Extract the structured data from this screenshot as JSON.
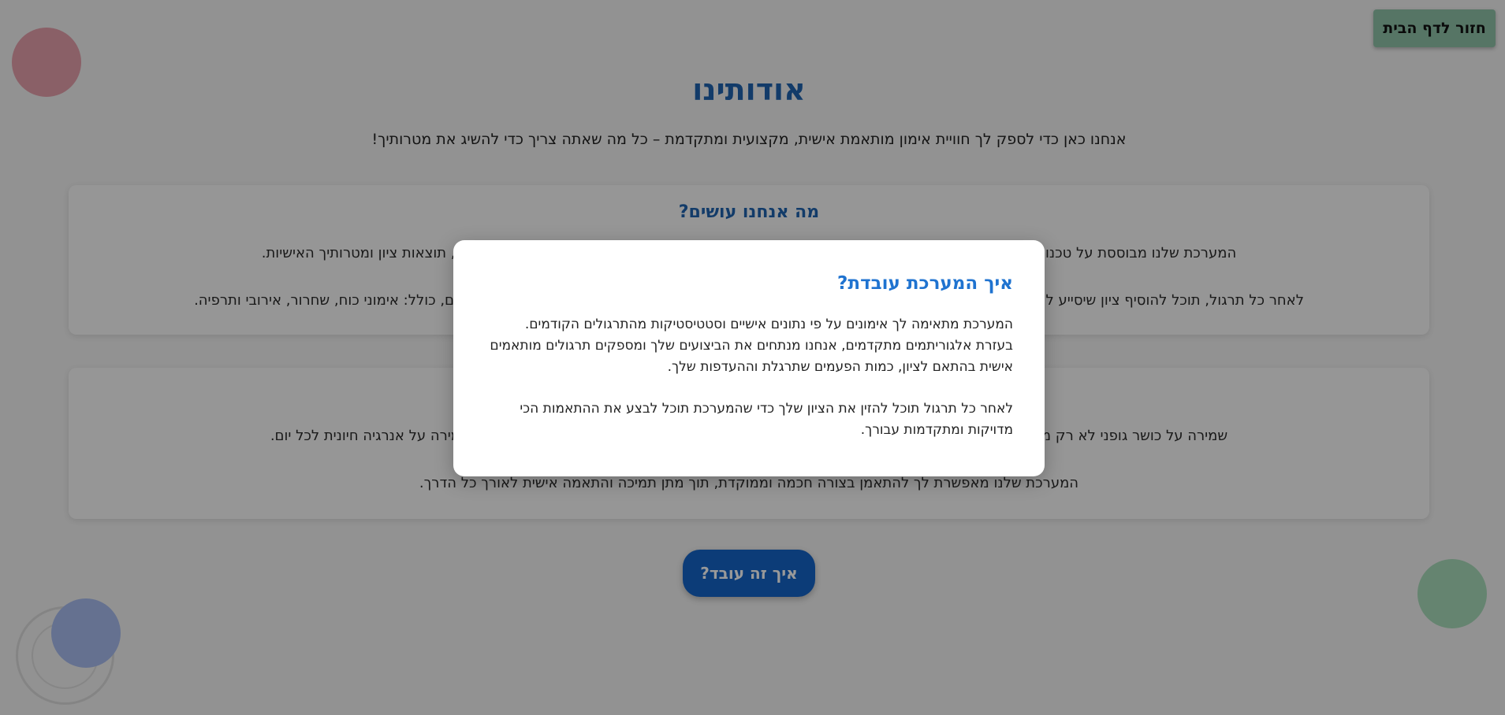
{
  "header": {
    "home_button_label": "חזור לדף הבית"
  },
  "main": {
    "title": "אודותינו",
    "intro": "אנחנו כאן כדי לספק לך חוויית אימון מותאמת אישית, מקצועית ומתקדמת – כל מה שאתה צריך כדי להשיג את מטרותיך!",
    "card1": {
      "title": "מה אנחנו עושים?",
      "paragraph1": "המערכת שלנו מבוססת על טכנולוגיות חכמות המאפשרות התאמה אישית של תוכנית האימונים שלך, בהתאם לנתונים כמו ניסיון עבר, תוצאות ציון ומטרותיך האישיות.",
      "paragraph2": "לאחר כל תרגול, תוכל להוסיף ציון שיסייע לנו להתאים לך את התרגולים הבאים בצורה מדויקת יותר. אנו מציעים מגוון תרגולים מגוונים בכל תחום, כולל: אימוני כוח, שחרור, אירובי ותרפיה."
    },
    "card2": {
      "paragraph1": "שמירה על כושר גופני לא רק משפרת את הבריאות הפיזית, אלא גם תורמת לבריאות הנפשית, הפחתת לחץ, שיפור מצב הרוח, ושמירה על אנרגיה חיונית לכל יום.",
      "paragraph2": "המערכת שלנו מאפשרת לך להתאמן בצורה חכמה וממוקדת, תוך מתן תמיכה והתאמה אישית לאורך כל הדרך."
    },
    "how_button_label": "איך זה עובד?"
  },
  "modal": {
    "title": "איך המערכת עובדת?",
    "paragraph1": "המערכת מתאימה לך אימונים על פי נתונים אישיים וסטטיסטיקות מהתרגולים הקודמים. בעזרת אלגוריתמים מתקדמים, אנחנו מנתחים את הביצועים שלך ומספקים תרגולים מותאמים אישית בהתאם לציון, כמות הפעמים שתרגלת וההעדפות שלך.",
    "paragraph2": "לאחר כל תרגול תוכל להזין את הציון שלך כדי שהמערכת תוכל לבצע את ההתאמות הכי מדויקות ומתקדמות עבורך."
  },
  "colors": {
    "accent": "#1f63b0",
    "home_button": "#8fc3a8",
    "how_button": "#1565c8"
  }
}
